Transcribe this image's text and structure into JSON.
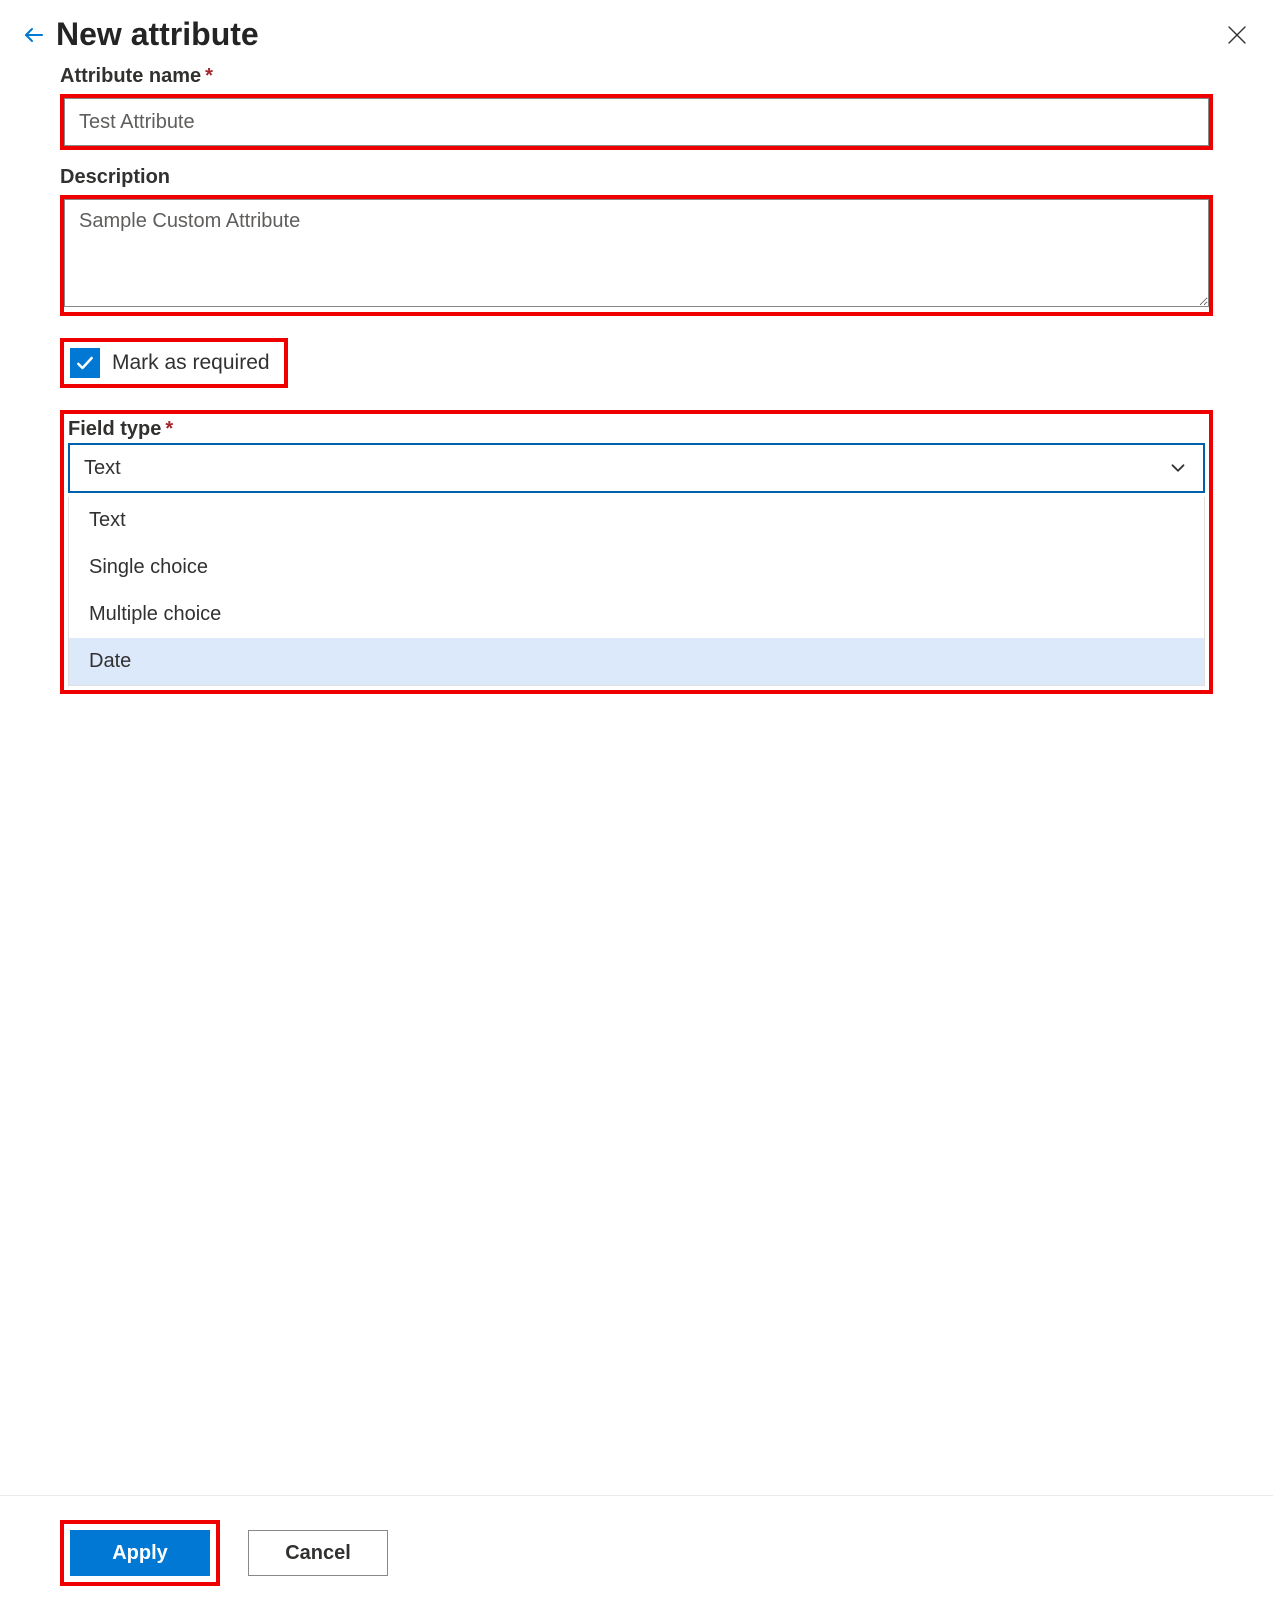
{
  "header": {
    "title": "New attribute"
  },
  "fields": {
    "name_label": "Attribute name",
    "name_value": "Test Attribute",
    "desc_label": "Description",
    "desc_value": "Sample Custom Attribute",
    "required_label": "Mark as required",
    "required_checked": true,
    "type_label": "Field type",
    "type_selected": "Text",
    "type_options": [
      "Text",
      "Single choice",
      "Multiple choice",
      "Date"
    ],
    "type_highlighted_index": 3
  },
  "footer": {
    "apply": "Apply",
    "cancel": "Cancel"
  }
}
